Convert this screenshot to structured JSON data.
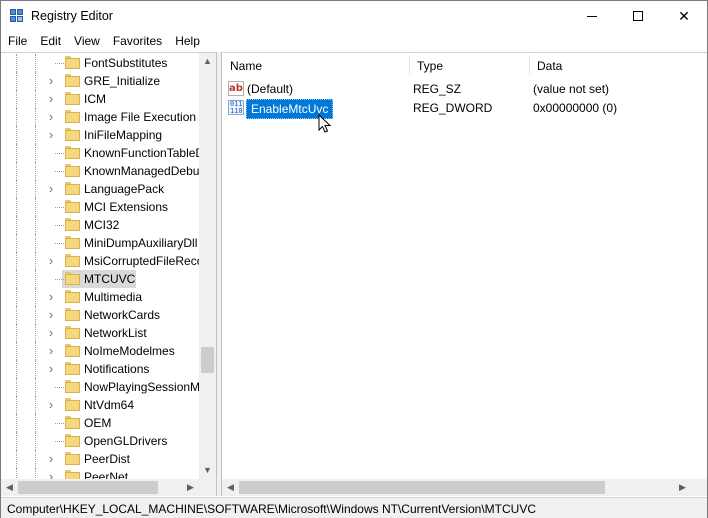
{
  "window": {
    "title": "Registry Editor",
    "minimize_glyph": "",
    "maximize_glyph": "",
    "close_glyph": "✕"
  },
  "menu": [
    "File",
    "Edit",
    "View",
    "Favorites",
    "Help"
  ],
  "tree": {
    "items": [
      {
        "label": "FontSubstitutes",
        "expandable": false,
        "selected": false
      },
      {
        "label": "GRE_Initialize",
        "expandable": true,
        "selected": false
      },
      {
        "label": "ICM",
        "expandable": true,
        "selected": false
      },
      {
        "label": "Image File Execution O",
        "expandable": true,
        "selected": false
      },
      {
        "label": "IniFileMapping",
        "expandable": true,
        "selected": false
      },
      {
        "label": "KnownFunctionTableDl",
        "expandable": false,
        "selected": false
      },
      {
        "label": "KnownManagedDebu",
        "expandable": false,
        "selected": false
      },
      {
        "label": "LanguagePack",
        "expandable": true,
        "selected": false
      },
      {
        "label": "MCI Extensions",
        "expandable": false,
        "selected": false
      },
      {
        "label": "MCI32",
        "expandable": false,
        "selected": false
      },
      {
        "label": "MiniDumpAuxiliaryDll",
        "expandable": false,
        "selected": false
      },
      {
        "label": "MsiCorruptedFileReco",
        "expandable": true,
        "selected": false
      },
      {
        "label": "MTCUVC",
        "expandable": false,
        "selected": true
      },
      {
        "label": "Multimedia",
        "expandable": true,
        "selected": false
      },
      {
        "label": "NetworkCards",
        "expandable": true,
        "selected": false
      },
      {
        "label": "NetworkList",
        "expandable": true,
        "selected": false
      },
      {
        "label": "NoImeModelmes",
        "expandable": true,
        "selected": false
      },
      {
        "label": "Notifications",
        "expandable": true,
        "selected": false
      },
      {
        "label": "NowPlayingSessionM",
        "expandable": false,
        "selected": false
      },
      {
        "label": "NtVdm64",
        "expandable": true,
        "selected": false
      },
      {
        "label": "OEM",
        "expandable": false,
        "selected": false
      },
      {
        "label": "OpenGLDrivers",
        "expandable": false,
        "selected": false
      },
      {
        "label": "PeerDist",
        "expandable": true,
        "selected": false
      },
      {
        "label": "PeerNet",
        "expandable": true,
        "selected": false
      }
    ]
  },
  "list": {
    "columns": {
      "name": "Name",
      "type": "Type",
      "data": "Data"
    },
    "rows": [
      {
        "icon": "string-value-icon",
        "icon_text": "ab",
        "name": "(Default)",
        "type": "REG_SZ",
        "data": "(value not set)",
        "selected": false
      },
      {
        "icon": "binary-value-icon",
        "icon_text": "011 110",
        "name": "EnableMtcUvc",
        "type": "REG_DWORD",
        "data": "0x00000000 (0)",
        "selected": true
      }
    ]
  },
  "status": {
    "path": "Computer\\HKEY_LOCAL_MACHINE\\SOFTWARE\\Microsoft\\Windows NT\\CurrentVersion\\MTCUVC"
  },
  "colors": {
    "selection": "#0078d7",
    "tree_selection": "#d9d9d9",
    "folder": "#f5d77e"
  }
}
